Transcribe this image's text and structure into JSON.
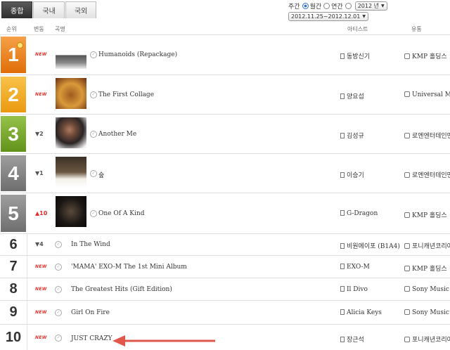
{
  "tabs": [
    "종합",
    "국내",
    "국외"
  ],
  "filters": {
    "weekly": "주간",
    "monthly": "월간",
    "yearly": "연간",
    "year_select": "2012 년",
    "period_select": "2012.11.25~2012.12.01"
  },
  "header": {
    "rank": "순위",
    "change": "변동",
    "song": "곡명",
    "artist": "아티스트",
    "distributor": "유통"
  },
  "rows": [
    {
      "rank": "1",
      "change": "NEW",
      "title": "Humanoids (Repackage)",
      "artist": "동방신기",
      "label": "KMP 홀딩스",
      "color": "#f08a1c"
    },
    {
      "rank": "2",
      "change": "NEW",
      "title": "The First Collage",
      "artist": "양요섭",
      "label": "Universal Music",
      "color": "#f3ac1e"
    },
    {
      "rank": "3",
      "change": "▼2",
      "title": "Another Me",
      "artist": "김성규",
      "label": "로엔엔터테인먼트",
      "color": "#7fae2e"
    },
    {
      "rank": "4",
      "change": "▼1",
      "title": "숲",
      "artist": "이승기",
      "label": "로엔엔터테인먼트",
      "color": "#8a8a8a"
    },
    {
      "rank": "5",
      "change": "▲10",
      "title": "One Of A Kind",
      "artist": "G-Dragon",
      "label": "KMP 홀딩스",
      "color": "#8a8a8a"
    },
    {
      "rank": "6",
      "change": "▼4",
      "title": "In The Wind",
      "artist": "비원에이포 (B1A4)",
      "label": "포니캐년코리아"
    },
    {
      "rank": "7",
      "change": "NEW",
      "title": "'MAMA' EXO-M The 1st Mini Album",
      "artist": "EXO-M",
      "label": "KMP 홀딩스"
    },
    {
      "rank": "8",
      "change": "NEW",
      "title": "The Greatest Hits (Gift Edition)",
      "artist": "Il Divo",
      "label": "Sony Music"
    },
    {
      "rank": "9",
      "change": "NEW",
      "title": "Girl On Fire",
      "artist": "Alicia Keys",
      "label": "Sony Music"
    },
    {
      "rank": "10",
      "change": "NEW",
      "title": "JUST CRAZY",
      "artist": "장근석",
      "label": "포니캐년코리아"
    }
  ]
}
